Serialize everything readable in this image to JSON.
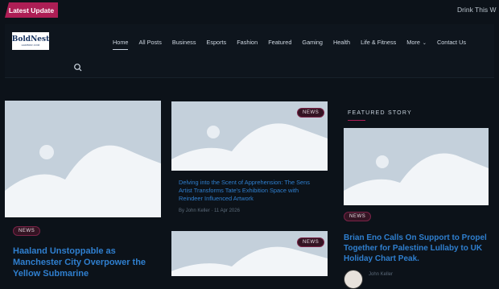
{
  "topbar": {
    "latest_label": "Latest Update",
    "ticker_text": "Drink This W"
  },
  "logo": {
    "line1": "BoldNest",
    "line2": "HARBOR.COM"
  },
  "nav": {
    "items": [
      "Home",
      "All Posts",
      "Business",
      "Esports",
      "Fashion",
      "Featured",
      "Gaming",
      "Health",
      "Life & Fitness",
      "More",
      "Contact Us"
    ],
    "active": "Home"
  },
  "cards": {
    "left": {
      "badge": "News",
      "title": "Haaland Unstoppable as Manchester City Overpower the Yellow Submarine"
    },
    "middle_top": {
      "badge": "News",
      "title": "Delving into the Scent of Apprehension: The Sens Artist Transforms Tate's Exhibition Space with Reindeer Influenced Artwork",
      "author": "By John Keller",
      "date": "11 Apr 2026"
    },
    "middle_bottom": {
      "badge": "News"
    }
  },
  "featured": {
    "heading": "FEATURED STORY",
    "badge": "News",
    "title": "Brian Eno Calls On Support to Propel Together for Palestine Lullaby to UK Holiday Chart Peak.",
    "author": "John Keller"
  },
  "colors": {
    "accent": "#ad1e55",
    "link": "#2f7fcf",
    "background": "#0c1219",
    "placeholder": "#c4d0db"
  },
  "icons": [
    "search-icon",
    "chevron-down-icon",
    "image-placeholder-icon"
  ]
}
